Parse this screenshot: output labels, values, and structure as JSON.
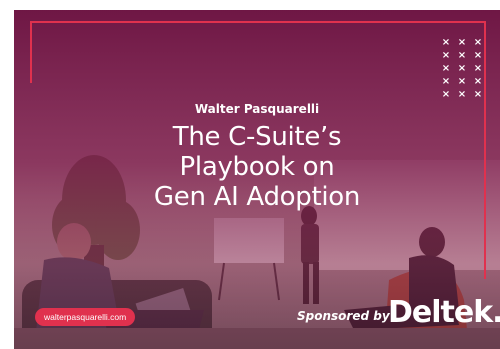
{
  "author": "Walter Pasquarelli",
  "title_lines": [
    "The C-Suite’s",
    "Playbook on",
    "Gen AI Adoption"
  ],
  "url": "walterpasquarelli.com",
  "sponsor_label": "Sponsored by",
  "sponsor_logo_text": "Deltek.",
  "dot_glyph": "×",
  "colors": {
    "accent": "#e0314e",
    "overlay": "#7a1a4a",
    "text": "#ffffff"
  }
}
